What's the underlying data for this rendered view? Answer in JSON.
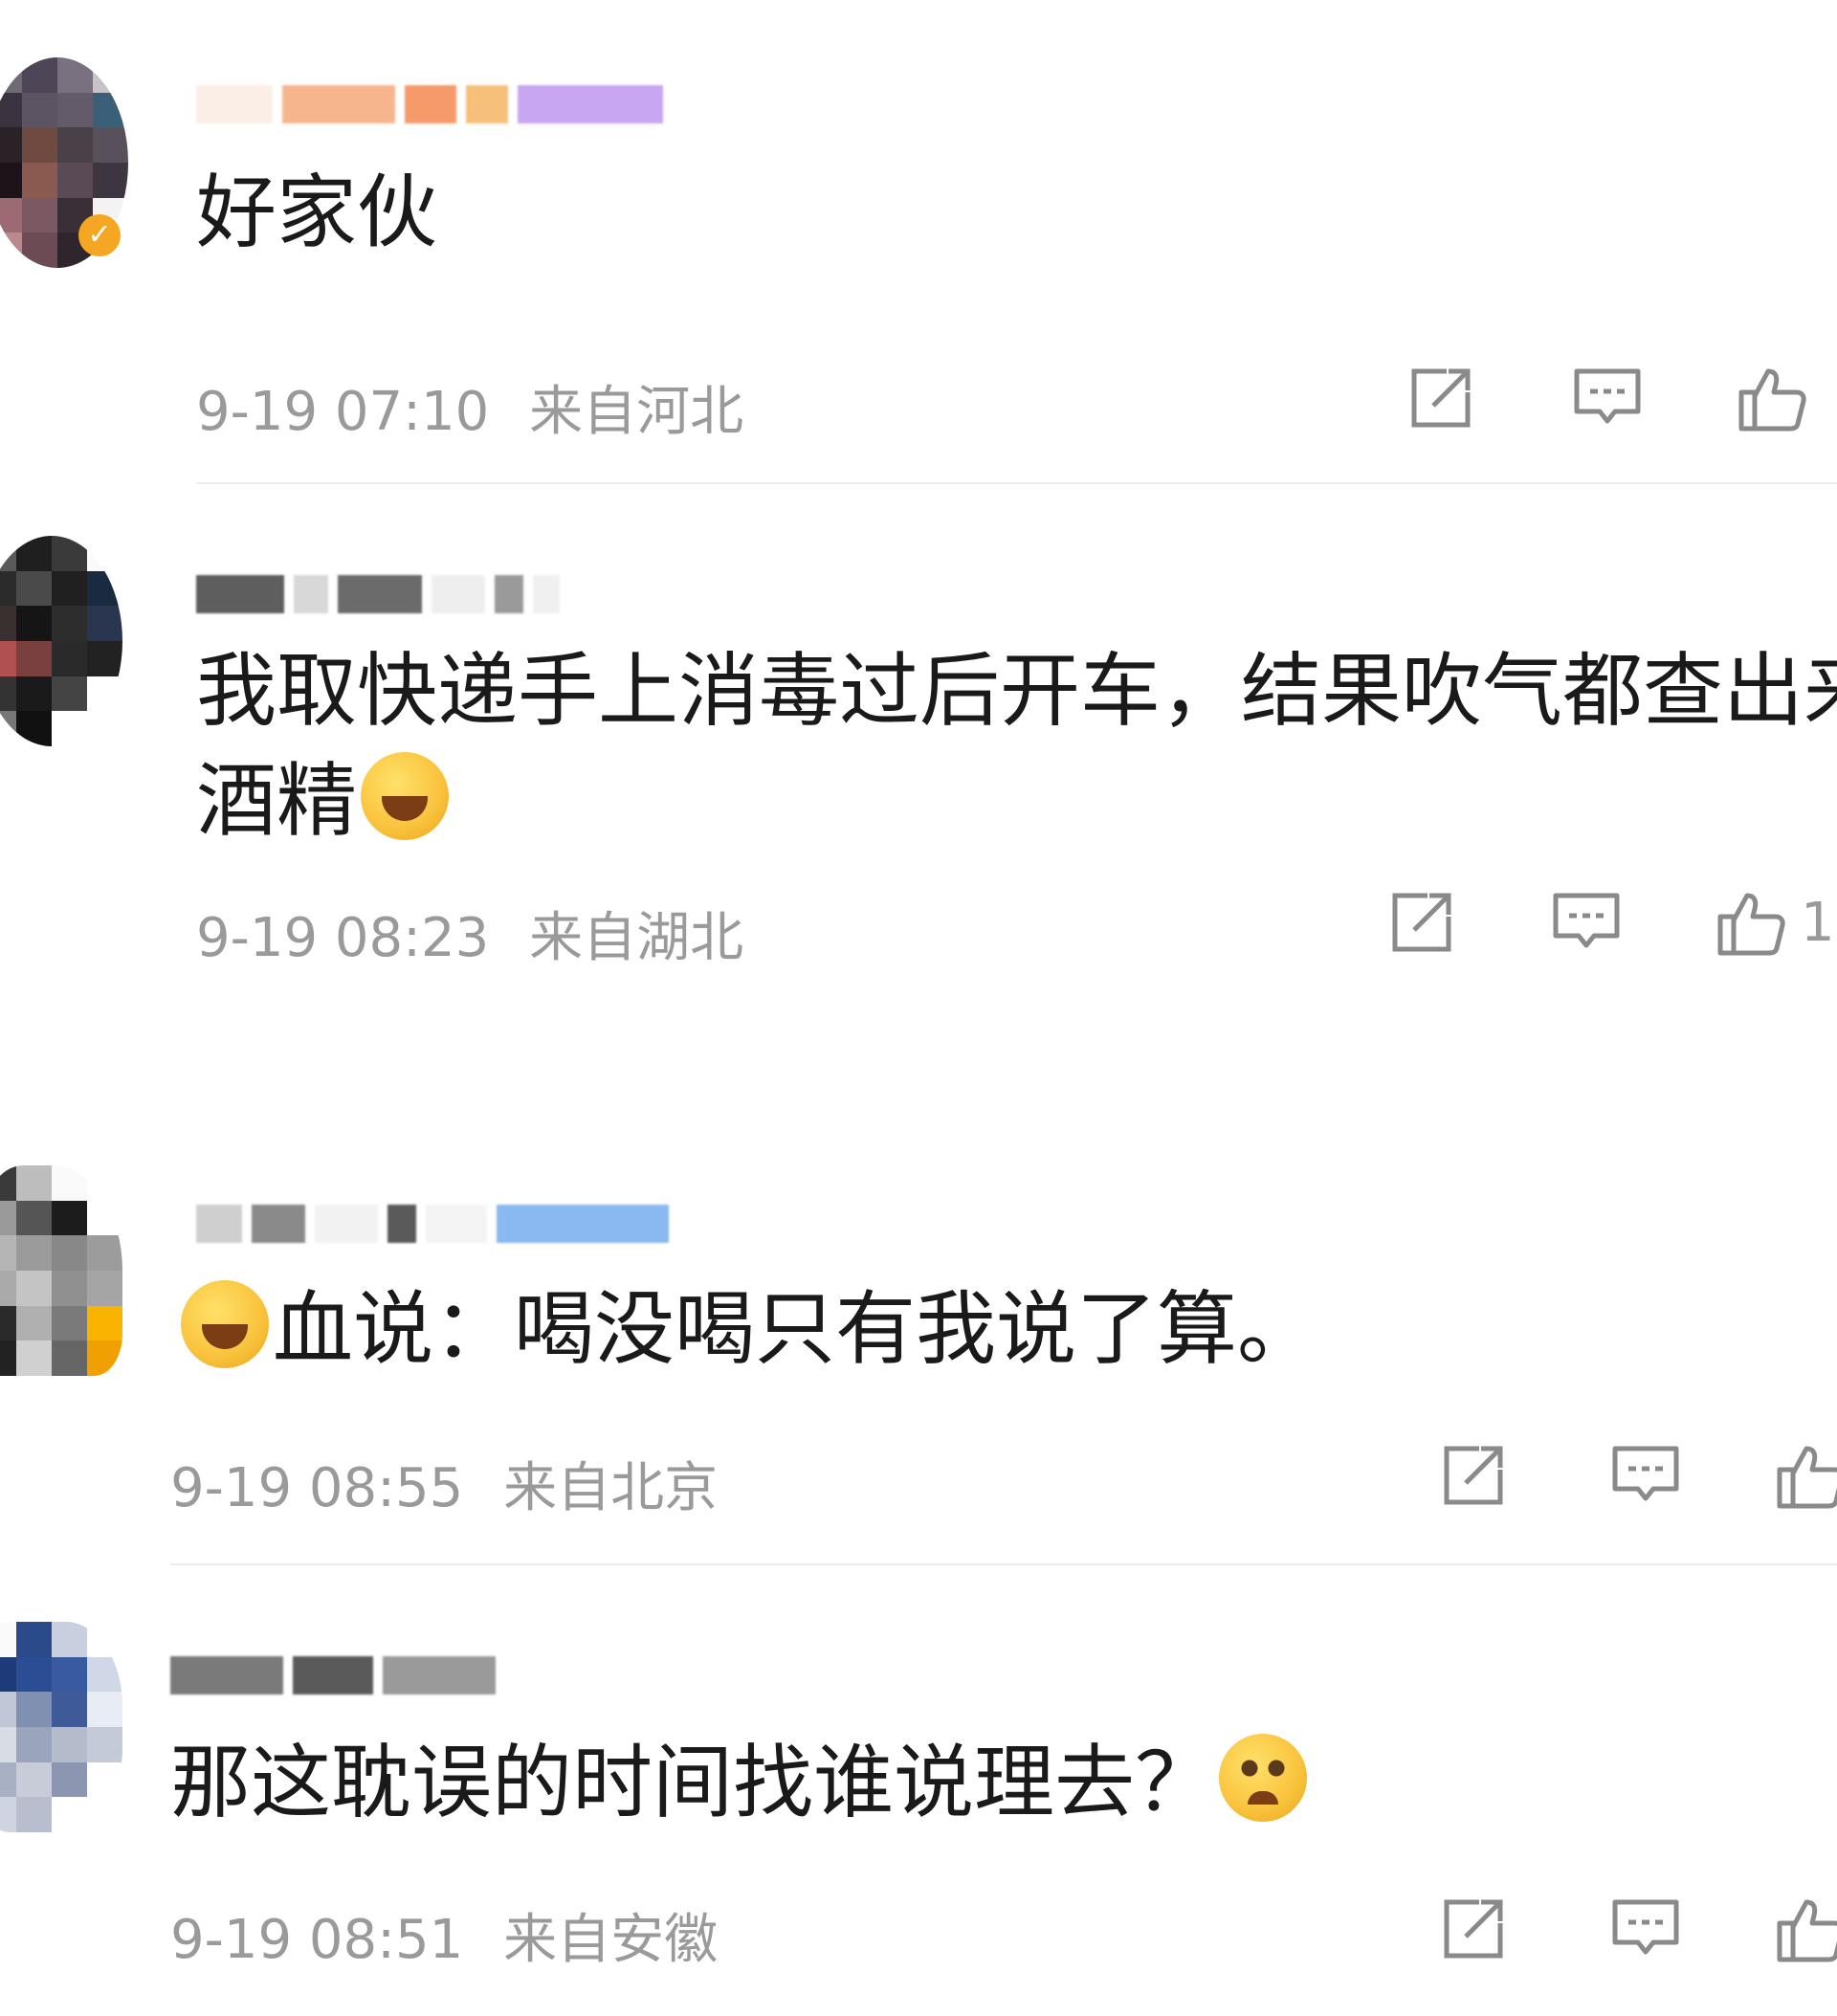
{
  "comments": [
    {
      "text": "好家伙",
      "time": "9-19 07:10",
      "location": "来自河北",
      "like_count": ""
    },
    {
      "text_line1": "我取快递手上消毒过后开车，结果吹气都查出来",
      "text_line2": "酒精",
      "time": "9-19 08:23",
      "location": "来自湖北",
      "like_count": "1"
    },
    {
      "text": "血说：喝没喝只有我说了算。",
      "time": "9-19 08:55",
      "location": "来自北京",
      "like_count": ""
    },
    {
      "text": "那这耽误的时间找谁说理去？",
      "time": "9-19 08:51",
      "location": "来自安徽",
      "like_count": ""
    }
  ],
  "icons": {
    "share": "share-icon",
    "reply": "comment-icon",
    "like": "thumbs-up-icon",
    "laugh_cry": "laughing-crying-emoji",
    "sad": "sad-teary-emoji",
    "verified": "verified-badge-icon"
  },
  "colors": {
    "text": "#1a1a1a",
    "meta": "#9a9a9a",
    "divider": "#ececec",
    "verified": "#f5a623"
  }
}
